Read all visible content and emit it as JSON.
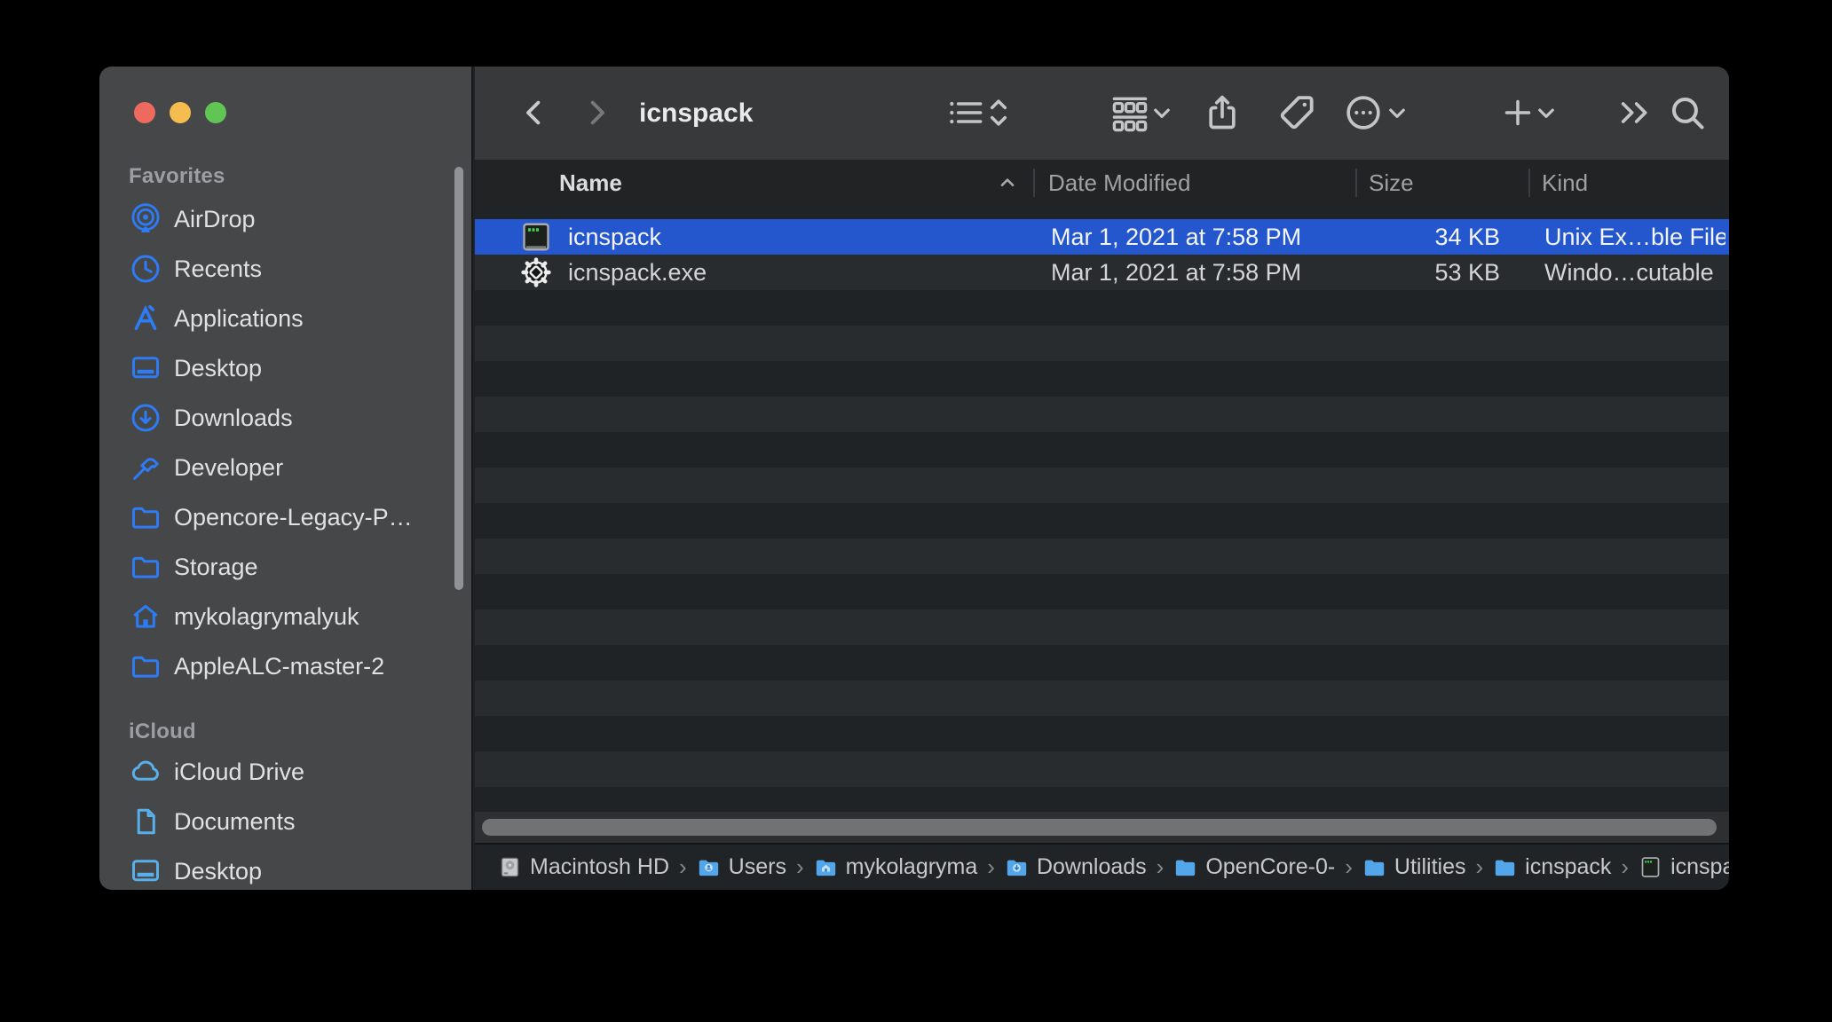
{
  "window": {
    "title": "icnspack"
  },
  "traffic_lights": {
    "close_color": "#ee6a5f",
    "minimize_color": "#f5bd4f",
    "zoom_color": "#61c555"
  },
  "toolbar": {
    "icons": [
      "chevron-left-icon",
      "chevron-right-icon",
      "list-view-icon",
      "sort-chevrons-icon",
      "group-by-icon",
      "chevron-down-icon",
      "share-icon",
      "tag-icon",
      "more-actions-icon",
      "chevron-down-icon",
      "new-item-plus-icon",
      "chevron-down-icon",
      "show-more-chevrons-icon",
      "search-icon"
    ]
  },
  "sidebar": {
    "accent_color": "#2e7bf6",
    "icloud_icon_color": "#58b0ea",
    "sections": [
      {
        "label": "Favorites",
        "items": [
          {
            "label": "AirDrop",
            "icon": "airdrop-icon"
          },
          {
            "label": "Recents",
            "icon": "clock-icon"
          },
          {
            "label": "Applications",
            "icon": "app-store-icon"
          },
          {
            "label": "Desktop",
            "icon": "desktop-icon"
          },
          {
            "label": "Downloads",
            "icon": "download-circle-icon"
          },
          {
            "label": "Developer",
            "icon": "hammer-icon"
          },
          {
            "label": "Opencore-Legacy-P…",
            "icon": "folder-icon"
          },
          {
            "label": "Storage",
            "icon": "folder-icon"
          },
          {
            "label": "mykolagrymalyuk",
            "icon": "home-icon"
          },
          {
            "label": "AppleALC-master-2",
            "icon": "folder-icon"
          }
        ]
      },
      {
        "label": "iCloud",
        "items": [
          {
            "label": "iCloud Drive",
            "icon": "cloud-icon"
          },
          {
            "label": "Documents",
            "icon": "document-icon"
          },
          {
            "label": "Desktop",
            "icon": "desktop-icon"
          }
        ]
      }
    ]
  },
  "list": {
    "selection_color": "#2457cd",
    "columns": [
      {
        "label": "Name",
        "sort": "ascending"
      },
      {
        "label": "Date Modified"
      },
      {
        "label": "Size"
      },
      {
        "label": "Kind"
      }
    ],
    "rows": [
      {
        "name": "icnspack",
        "date_modified": "Mar 1, 2021 at 7:58 PM",
        "size": "34 KB",
        "kind": "Unix Ex…ble File",
        "icon": "unix-executable-icon",
        "selected": true
      },
      {
        "name": "icnspack.exe",
        "date_modified": "Mar 1, 2021 at 7:58 PM",
        "size": "53 KB",
        "kind": "Windo…cutable",
        "icon": "windows-executable-icon",
        "selected": false
      }
    ]
  },
  "path_bar": {
    "separator": "›",
    "segments": [
      {
        "label": "Macintosh HD",
        "icon": "hard-drive-icon"
      },
      {
        "label": "Users",
        "icon": "folder-users-icon"
      },
      {
        "label": "mykolagryma",
        "icon": "folder-home-icon"
      },
      {
        "label": "Downloads",
        "icon": "folder-downloads-icon"
      },
      {
        "label": "OpenCore-0-",
        "icon": "folder-icon"
      },
      {
        "label": "Utilities",
        "icon": "folder-icon"
      },
      {
        "label": "icnspack",
        "icon": "folder-icon"
      },
      {
        "label": "icnspack",
        "icon": "unix-executable-icon"
      }
    ]
  }
}
